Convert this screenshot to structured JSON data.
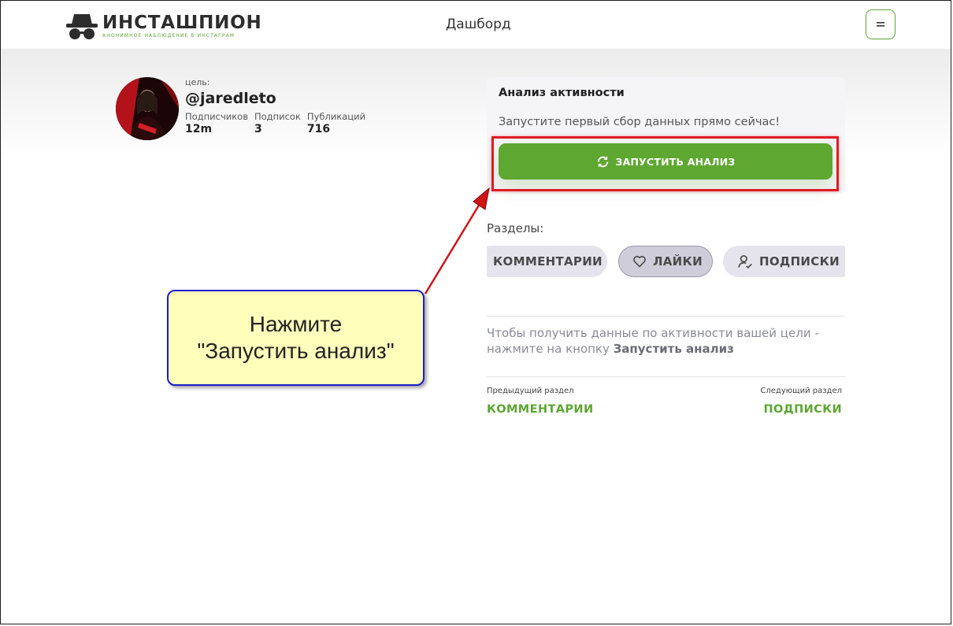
{
  "header": {
    "brand_name": "ИНСТАШПИОН",
    "brand_tagline": "АНОНИМНОЕ НАБЛЮДЕНИЕ В ИНСТАГРАМ",
    "nav_title": "Дашборд",
    "menu_icon": "menu-icon"
  },
  "profile": {
    "target_label": "цель:",
    "handle": "@jaredleto",
    "stats": [
      {
        "label": "Подписчиков",
        "value": "12m"
      },
      {
        "label": "Подписок",
        "value": "3"
      },
      {
        "label": "Публикаций",
        "value": "716"
      }
    ]
  },
  "activity": {
    "title": "Анализ активности",
    "description": "Запустите первый сбор данных прямо сейчас!",
    "run_button_label": "ЗАПУСТИТЬ АНАЛИЗ",
    "run_icon": "refresh-icon"
  },
  "sections": {
    "label": "Разделы:",
    "pills": [
      {
        "label": "КОММЕНТАРИИ",
        "icon": "comment-icon",
        "active": false
      },
      {
        "label": "ЛАЙКИ",
        "icon": "heart-icon",
        "active": true
      },
      {
        "label": "ПОДПИСКИ",
        "icon": "user-check-icon",
        "active": false
      }
    ]
  },
  "info": {
    "text_prefix": "Чтобы получить данные по активности вашей цели - нажмите на кнопку ",
    "text_bold": "Запустить анализ"
  },
  "pager": {
    "prev_caption": "Предыдущий раздел",
    "prev_link": "КОММЕНТАРИИ",
    "next_caption": "Следующий раздел",
    "next_link": "ПОДПИСКИ"
  },
  "callout": {
    "line1": "Нажмите",
    "line2": "\"Запустить анализ\""
  },
  "colors": {
    "brand_green": "#5ea831",
    "highlight_red": "#e01b24",
    "callout_bg": "#ffffbb",
    "callout_border": "#1c1ccf"
  }
}
